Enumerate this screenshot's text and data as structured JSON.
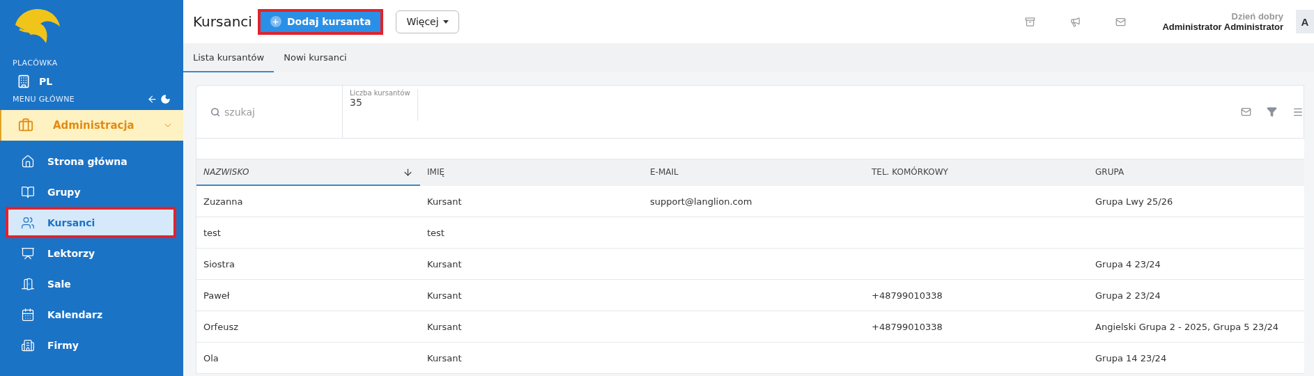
{
  "sidebar": {
    "branch_label": "PLACÓWKA",
    "branch": "PL",
    "menu_label": "MENU GŁÓWNE",
    "section": {
      "label": "Administracja",
      "expanded": true
    },
    "items": [
      {
        "label": "Strona główna",
        "selected": false,
        "highlighted": false
      },
      {
        "label": "Grupy",
        "selected": false,
        "highlighted": false
      },
      {
        "label": "Kursanci",
        "selected": true,
        "highlighted": true
      },
      {
        "label": "Lektorzy",
        "selected": false,
        "highlighted": false
      },
      {
        "label": "Sale",
        "selected": false,
        "highlighted": false
      },
      {
        "label": "Kalendarz",
        "selected": false,
        "highlighted": false
      },
      {
        "label": "Firmy",
        "selected": false,
        "highlighted": false
      }
    ]
  },
  "header": {
    "title": "Kursanci",
    "add_button": {
      "label": "Dodaj kursanta",
      "highlighted": true
    },
    "more_button": "Więcej",
    "greeting": "Dzień dobry",
    "user": "Administrator Administrator",
    "avatar": "A"
  },
  "tabs": [
    {
      "label": "Lista kursantów",
      "selected": true
    },
    {
      "label": "Nowi kursanci",
      "selected": false
    }
  ],
  "search": {
    "placeholder": "szukaj"
  },
  "count": {
    "label": "Liczba kursantów",
    "value": "35"
  },
  "table": {
    "columns": [
      {
        "label": "NAZWISKO",
        "sorted": true
      },
      {
        "label": "IMIĘ",
        "sorted": false
      },
      {
        "label": "E-MAIL",
        "sorted": false
      },
      {
        "label": "TEL. KOMÓRKOWY",
        "sorted": false
      },
      {
        "label": "GRUPA",
        "sorted": false
      }
    ],
    "rows": [
      [
        "Zuzanna",
        "Kursant",
        "support@langlion.com",
        "",
        "Grupa Lwy 25/26"
      ],
      [
        "test",
        "test",
        "",
        "",
        ""
      ],
      [
        "Siostra",
        "Kursant",
        "",
        "",
        "Grupa 4 23/24"
      ],
      [
        "Paweł",
        "Kursant",
        "",
        "+48799010338",
        "Grupa 2 23/24"
      ],
      [
        "Orfeusz",
        "Kursant",
        "",
        "+48799010338",
        "Angielski Grupa 2 - 2025, Grupa 5 23/24"
      ],
      [
        "Ola",
        "Kursant",
        "",
        "",
        "Grupa 14 23/24"
      ]
    ]
  }
}
